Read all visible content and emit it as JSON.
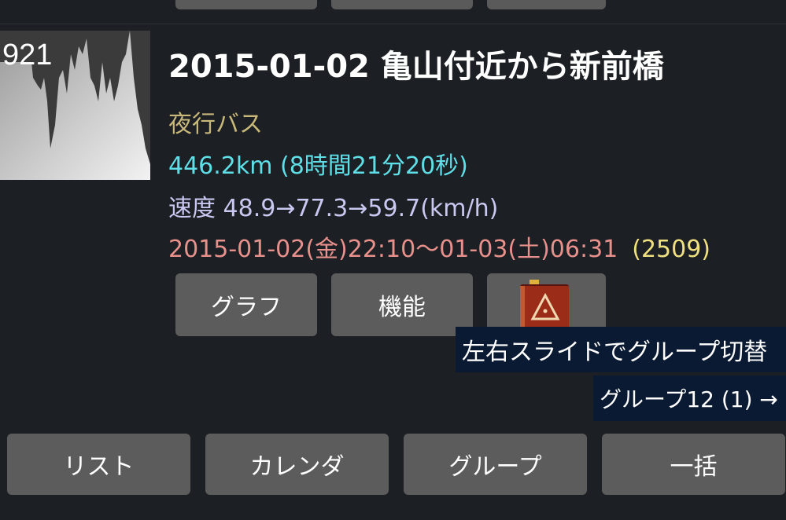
{
  "entry": {
    "thumb_label": "921",
    "title": "2015-01-02 亀山付近から新前橋",
    "type": "夜行バス",
    "distance": "446.2km (8時間21分20秒)",
    "speed": "速度 48.9→77.3→59.7(km/h)",
    "datetime": "2015-01-02(金)22:10〜01-03(土)06:31",
    "count": "(2509)"
  },
  "actions": {
    "graph": "グラフ",
    "functions": "機能"
  },
  "hints": {
    "swipe": "左右スライドでグループ切替",
    "group": "グループ12 (1) →"
  },
  "bottom_nav": {
    "list": "リスト",
    "calendar": "カレンダ",
    "group": "グループ",
    "batch": "一括"
  },
  "colors": {
    "background": "#1c1f23",
    "button": "#5c5c5c",
    "type_text": "#c8b87a",
    "distance_text": "#5fe0e8",
    "speed_text": "#c8c8f0",
    "datetime_text": "#e8908c",
    "count_text": "#f0e080",
    "tooltip_bg": "#0b1a33"
  }
}
